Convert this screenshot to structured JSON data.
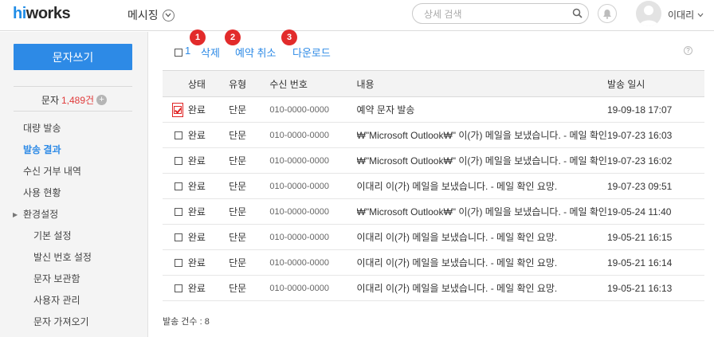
{
  "header": {
    "logo_hi": "hi",
    "logo_works": "works",
    "menu_title": "메시징",
    "search_placeholder": "상세 검색",
    "user_name": "이대리"
  },
  "sidebar": {
    "write_button": "문자쓰기",
    "count_label": "문자",
    "count_value": "1,489건",
    "items": [
      {
        "label": "대량 발송",
        "active": false
      },
      {
        "label": "발송 결과",
        "active": true
      },
      {
        "label": "수신 거부 내역",
        "active": false
      },
      {
        "label": "사용 현황",
        "active": false
      },
      {
        "label": "환경설정",
        "group": true
      },
      {
        "label": "기본 설정",
        "sub": true
      },
      {
        "label": "발신 번호 설정",
        "sub": true
      },
      {
        "label": "문자 보관함",
        "sub": true
      },
      {
        "label": "사용자 관리",
        "sub": true
      },
      {
        "label": "문자 가져오기",
        "sub": true
      }
    ]
  },
  "toolbar": {
    "selected_count": "1",
    "delete_label": "삭제",
    "cancel_label": "예약 취소",
    "download_label": "다운로드",
    "badges": [
      "1",
      "2",
      "3"
    ],
    "help": "?"
  },
  "table": {
    "headers": [
      "상태",
      "유형",
      "수신 번호",
      "내용",
      "발송 일시"
    ],
    "rows": [
      {
        "checked": true,
        "status": "완료",
        "type": "단문",
        "phone": "010-0000-0000",
        "content": "예약 문자 발송",
        "date": "19-09-18 17:07"
      },
      {
        "checked": false,
        "status": "완료",
        "type": "단문",
        "phone": "010-0000-0000",
        "content": "₩\"Microsoft Outlook₩\" 이(가) 메일을 보냈습니다. - 메일 확인",
        "date": "19-07-23 16:03"
      },
      {
        "checked": false,
        "status": "완료",
        "type": "단문",
        "phone": "010-0000-0000",
        "content": "₩\"Microsoft Outlook₩\" 이(가) 메일을 보냈습니다. - 메일 확인",
        "date": "19-07-23 16:02"
      },
      {
        "checked": false,
        "status": "완료",
        "type": "단문",
        "phone": "010-0000-0000",
        "content": "이대리 이(가) 메일을 보냈습니다. - 메일 확인 요망.",
        "date": "19-07-23 09:51"
      },
      {
        "checked": false,
        "status": "완료",
        "type": "단문",
        "phone": "010-0000-0000",
        "content": "₩\"Microsoft Outlook₩\" 이(가) 메일을 보냈습니다. - 메일 확인",
        "date": "19-05-24 11:40"
      },
      {
        "checked": false,
        "status": "완료",
        "type": "단문",
        "phone": "010-0000-0000",
        "content": "이대리 이(가) 메일을 보냈습니다. - 메일 확인 요망.",
        "date": "19-05-21 16:15"
      },
      {
        "checked": false,
        "status": "완료",
        "type": "단문",
        "phone": "010-0000-0000",
        "content": "이대리 이(가) 메일을 보냈습니다. - 메일 확인 요망.",
        "date": "19-05-21 16:14"
      },
      {
        "checked": false,
        "status": "완료",
        "type": "단문",
        "phone": "010-0000-0000",
        "content": "이대리 이(가) 메일을 보냈습니다. - 메일 확인 요망.",
        "date": "19-05-21 16:13"
      }
    ]
  },
  "footer": {
    "total_label": "발송 건수 : 8"
  },
  "colors": {
    "accent": "#2d8ae6",
    "badge": "#e22b2b",
    "count": "#e03a3a"
  }
}
